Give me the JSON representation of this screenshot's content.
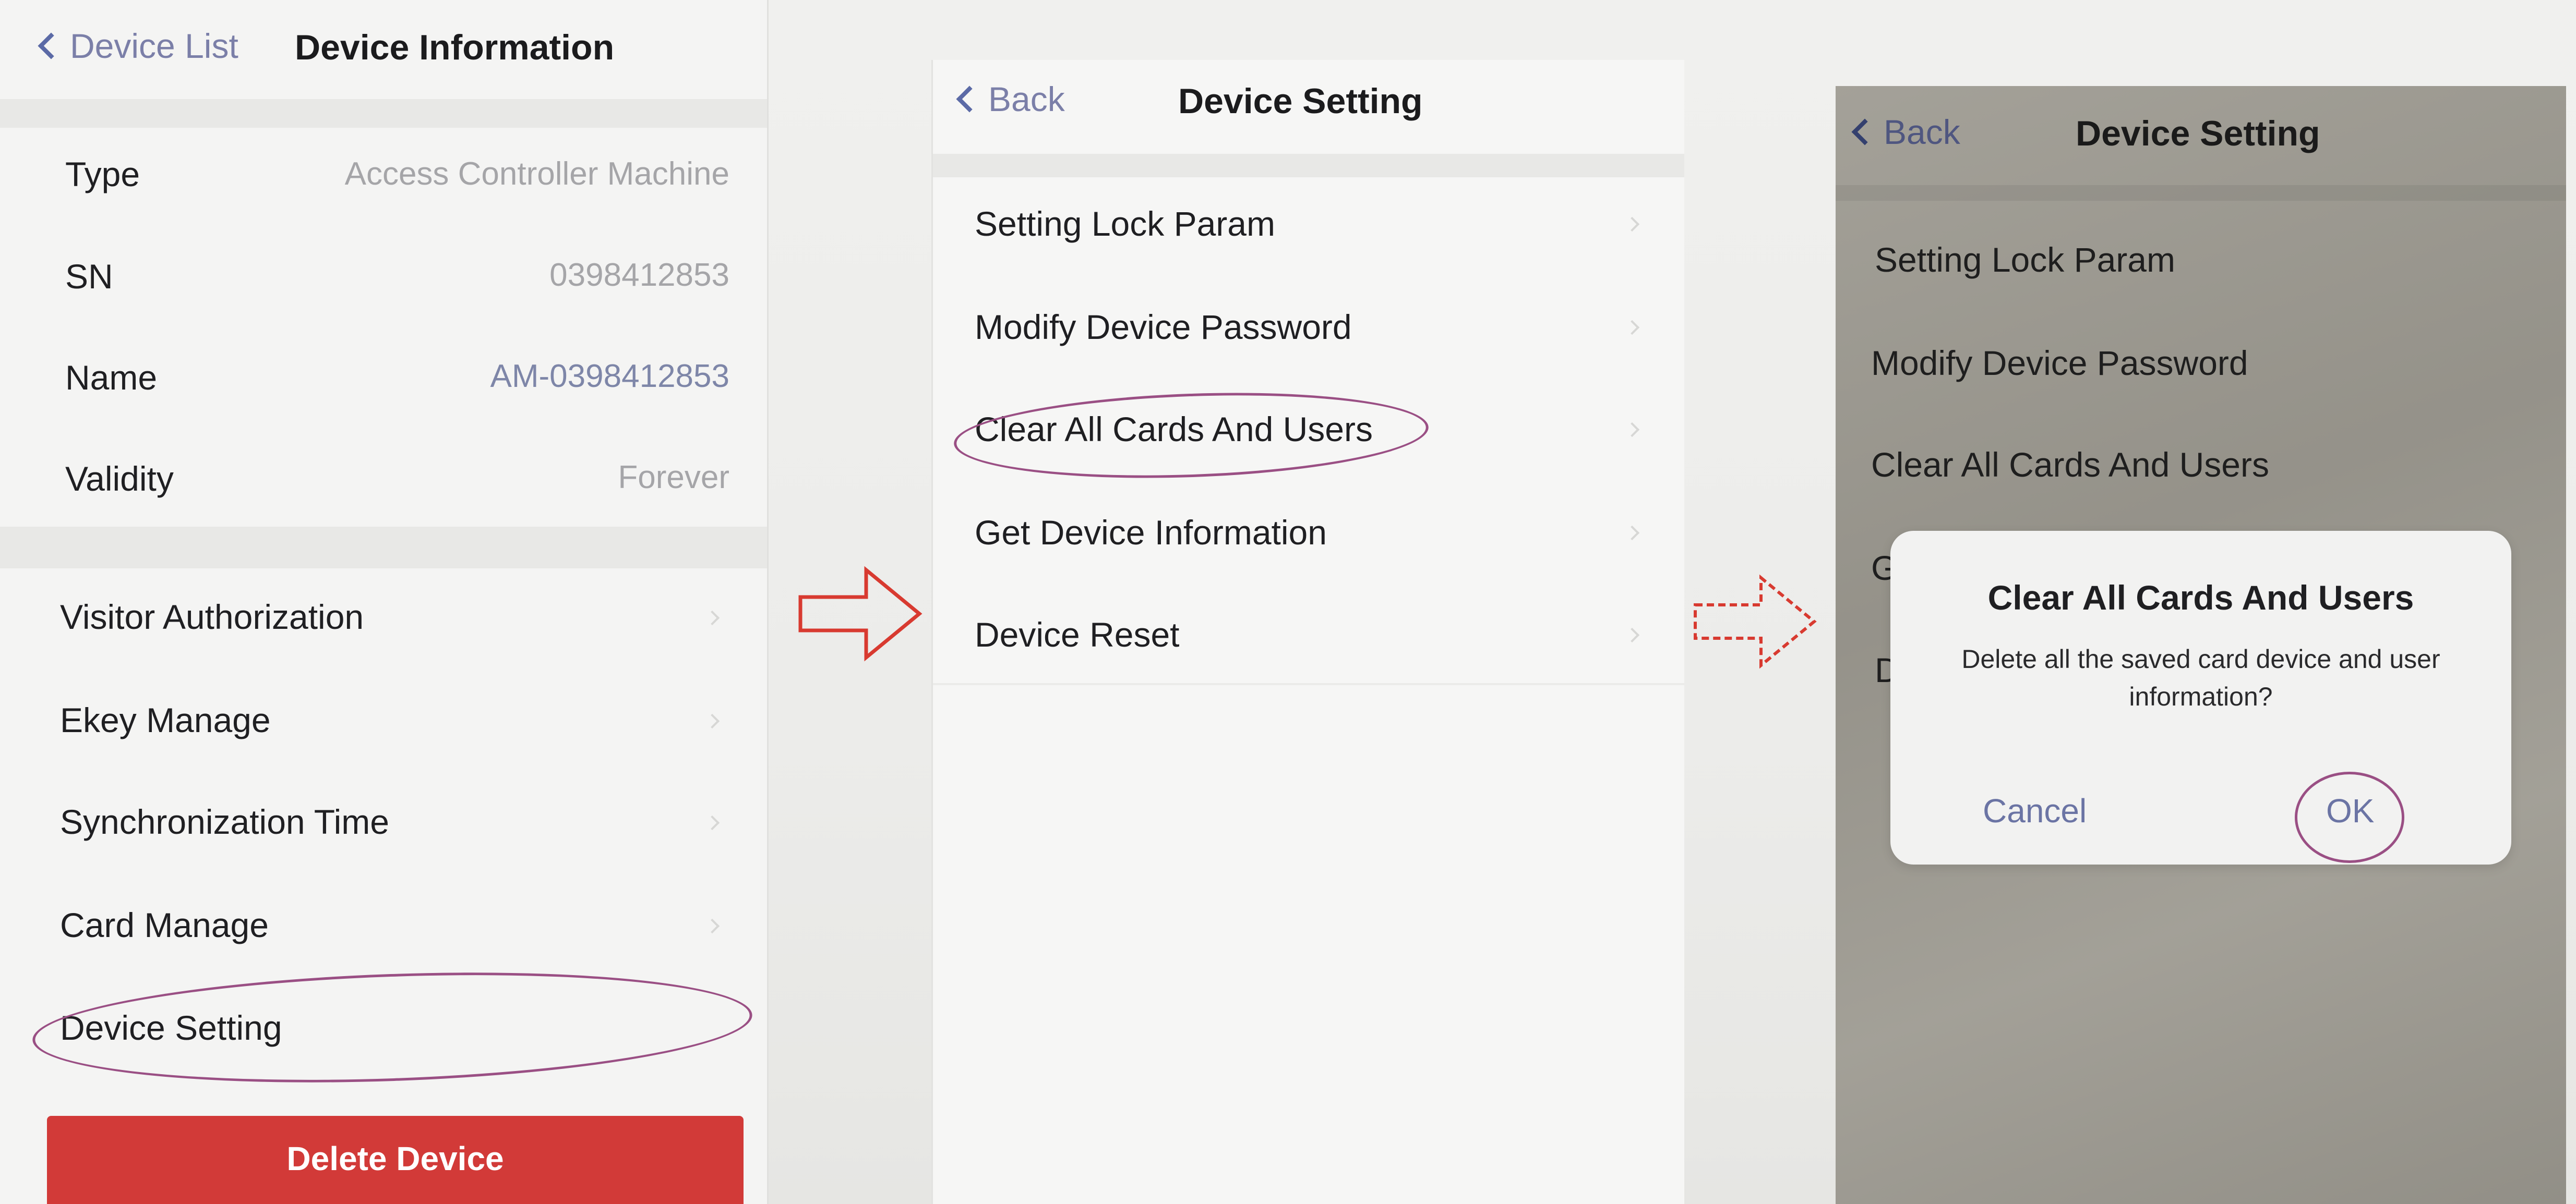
{
  "screen1": {
    "back_label": "Device List",
    "title": "Device Information",
    "info_rows": [
      {
        "label": "Type",
        "value": "Access Controller Machine"
      },
      {
        "label": "SN",
        "value": "0398412853"
      },
      {
        "label": "Name",
        "value": "AM-0398412853"
      },
      {
        "label": "Validity",
        "value": "Forever"
      }
    ],
    "menu_items": [
      "Visitor Authorization",
      "Ekey Manage",
      "Synchronization Time",
      "Card Manage",
      "Device Setting"
    ],
    "delete_label": "Delete Device"
  },
  "screen2": {
    "back_label": "Back",
    "title": "Device Setting",
    "items": [
      "Setting Lock Param",
      "Modify Device Password",
      "Clear All Cards And Users",
      "Get Device Information",
      "Device Reset"
    ]
  },
  "screen3": {
    "back_label": "Back",
    "title": "Device Setting",
    "items": [
      "Setting Lock Param",
      "Modify Device Password",
      "Clear All Cards And Users",
      "G",
      "D"
    ],
    "dialog": {
      "title": "Clear All Cards And Users",
      "message": "Delete all the saved card device and user information?",
      "cancel_label": "Cancel",
      "ok_label": "OK"
    }
  },
  "colors": {
    "annotation_oval": "#9a4f84",
    "arrow": "#d83a30",
    "delete_button": "#d23a38",
    "link": "#6b74a4"
  },
  "icons": [
    "chevron-left-icon",
    "chevron-right-icon",
    "arrow-right-icon"
  ]
}
